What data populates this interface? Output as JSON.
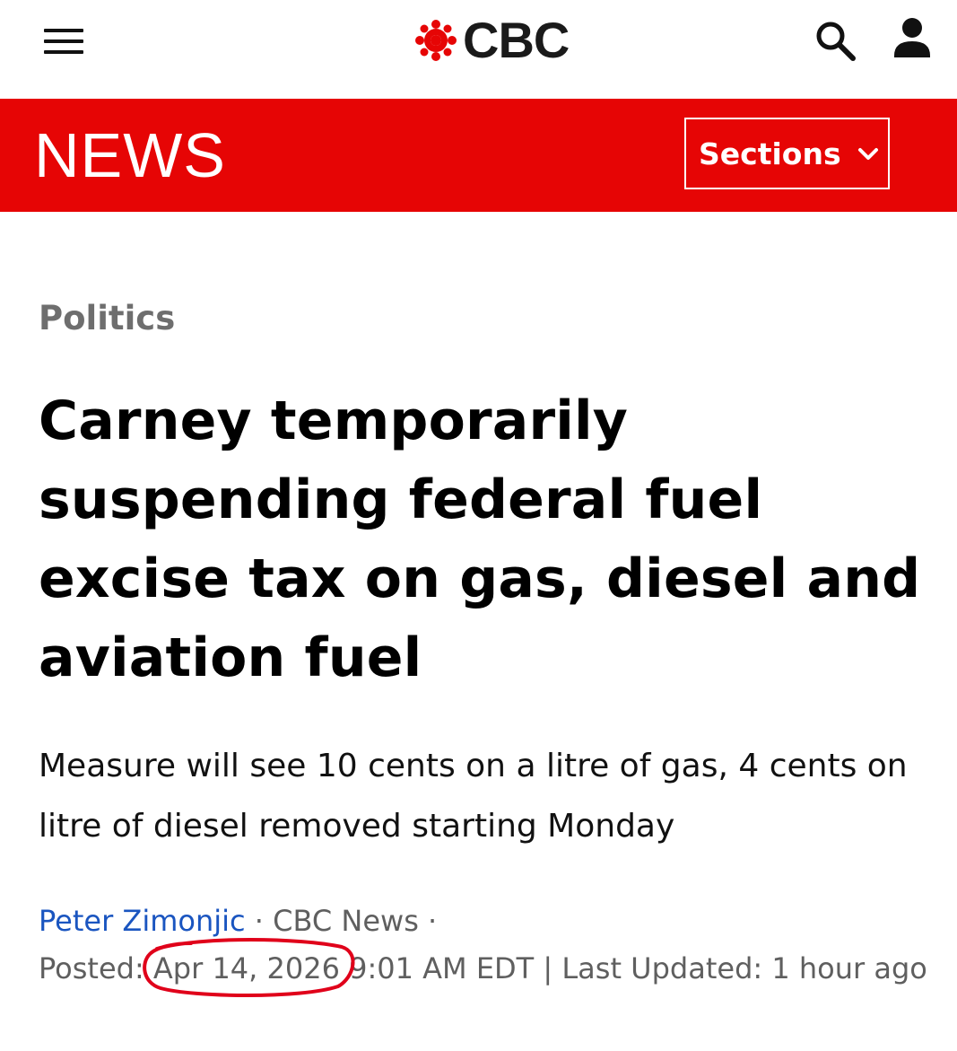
{
  "header": {
    "logo_text": "CBC",
    "menu_icon": "hamburger-menu-icon",
    "search_icon": "search-icon",
    "account_icon": "user-account-icon"
  },
  "newsbar": {
    "title": "NEWS",
    "sections_label": "Sections",
    "chevron_icon": "chevron-down-icon",
    "background_color": "#e60505"
  },
  "article": {
    "category": "Politics",
    "headline": "Carney temporarily suspending federal fuel excise tax on gas, diesel and aviation fuel",
    "deck": "Measure will see 10 cents on a litre of gas, 4 cents on litre of diesel removed starting Monday",
    "author": "Peter Zimonjic",
    "separator": " · ",
    "source": "CBC News",
    "posted_label": "Posted:",
    "posted_date": "Apr 14, 2026",
    "posted_time": "9:01 AM EDT",
    "divider": "|",
    "updated_label": "Last Updated:",
    "updated_value": "1 hour ago",
    "author_color": "#1a55c0",
    "annotation_color": "#e0001a"
  }
}
